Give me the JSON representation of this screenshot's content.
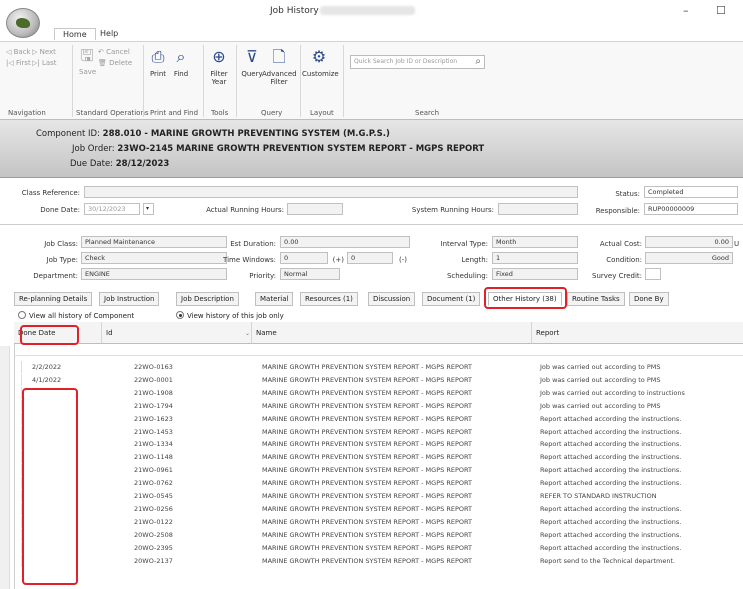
{
  "window": {
    "title": "Job History",
    "minimize": "–",
    "maximize": "☐"
  },
  "tabs": {
    "home": "Home",
    "help": "Help"
  },
  "ribbon": {
    "nav": {
      "back": "Back",
      "next": "Next",
      "first": "First",
      "last": "Last",
      "label": "Navigation"
    },
    "std": {
      "save": "Save",
      "cancel": "Cancel",
      "delete": "Delete",
      "label": "Standard Operations"
    },
    "print": {
      "print": "Print",
      "find": "Find",
      "label": "Print and Find"
    },
    "tools": {
      "filter_year": "Filter\nYear",
      "label": "Tools"
    },
    "query": {
      "query": "Query",
      "advanced": "Advanced\nFilter",
      "label": "Query"
    },
    "layout": {
      "customize": "Customize",
      "label": "Layout"
    },
    "search": {
      "placeholder": "Quick Search Job ID or Description",
      "label": "Search"
    }
  },
  "header": {
    "component_label": "Component ID:",
    "component_value": "288.010 - MARINE GROWTH PREVENTING SYSTEM (M.G.P.S.)",
    "job_order_label": "Job Order:",
    "job_order_value": "23WO-2145 MARINE GROWTH PREVENTION SYSTEM REPORT - MGPS REPORT",
    "due_label": "Due Date:",
    "due_value": "28/12/2023"
  },
  "form": {
    "class_ref_label": "Class Reference:",
    "class_ref": "",
    "done_date_label": "Done Date:",
    "done_date": "30/12/2023",
    "actual_running_label": "Actual Running Hours:",
    "actual_running": "",
    "system_running_label": "System Running Hours:",
    "system_running": "",
    "status_label": "Status:",
    "status": "Completed",
    "responsible_label": "Responsible:",
    "responsible": "RUP00000009",
    "job_class_label": "Job Class:",
    "job_class": "Planned Maintenance",
    "job_type_label": "Job Type:",
    "job_type": "Check",
    "department_label": "Department:",
    "department": "ENGINE",
    "est_duration_label": "Est Duration:",
    "est_duration": "0.00",
    "time_windows_label": "Time Windows:",
    "tw_minus": "0",
    "tw_plus_label": "(+)",
    "tw_plus": "0",
    "tw_minus_label": "(-)",
    "priority_label": "Priority:",
    "priority": "Normal",
    "interval_type_label": "Interval Type:",
    "interval_type": "Month",
    "length_label": "Length:",
    "length": "1",
    "scheduling_label": "Scheduling:",
    "scheduling": "Fixed",
    "actual_cost_label": "Actual Cost:",
    "actual_cost": "0.00",
    "actual_cost_unit": "U",
    "condition_label": "Condition:",
    "condition": "Good",
    "survey_credit_label": "Survey Credit:",
    "survey_credit": ""
  },
  "subtabs": [
    "Re-planning Details",
    "Job Instruction",
    "Job Description",
    "Material",
    "Resources (1)",
    "Discussion",
    "Document (1)",
    "Other History (38)",
    "Routine Tasks",
    "Done By"
  ],
  "radios": {
    "all": "View all history of Component",
    "this": "View history of this job only"
  },
  "columns": {
    "done_date": "Done Date",
    "id": "Id",
    "name": "Name",
    "report": "Report"
  },
  "rows": [
    {
      "date": "2/2/2022",
      "id": "22WO-0163",
      "name": "MARINE GROWTH PREVENTION SYSTEM REPORT - MGPS REPORT",
      "report": "Job was carried out according to PMS"
    },
    {
      "date": "4/1/2022",
      "id": "22WO-0001",
      "name": "MARINE GROWTH PREVENTION SYSTEM REPORT - MGPS REPORT",
      "report": "Job was carried out according to PMS"
    },
    {
      "date": "",
      "id": "21WO-1908",
      "name": "MARINE GROWTH PREVENTION SYSTEM REPORT - MGPS REPORT",
      "report": "Job was carried out according to instructions"
    },
    {
      "date": "",
      "id": "21WO-1794",
      "name": "MARINE GROWTH PREVENTION SYSTEM REPORT - MGPS REPORT",
      "report": "Job was carried out according to PMS"
    },
    {
      "date": "",
      "id": "21WO-1623",
      "name": "MARINE GROWTH PREVENTION SYSTEM REPORT - MGPS REPORT",
      "report": "Report attached according the instructions."
    },
    {
      "date": "",
      "id": "21WO-1453",
      "name": "MARINE GROWTH PREVENTION SYSTEM REPORT - MGPS REPORT",
      "report": "Report attached according the instructions."
    },
    {
      "date": "",
      "id": "21WO-1334",
      "name": "MARINE GROWTH PREVENTION SYSTEM REPORT - MGPS REPORT",
      "report": "Report attached according the instructions."
    },
    {
      "date": "",
      "id": "21WO-1148",
      "name": "MARINE GROWTH PREVENTION SYSTEM REPORT - MGPS REPORT",
      "report": "Report attached according the instructions."
    },
    {
      "date": "",
      "id": "21WO-0961",
      "name": "MARINE GROWTH PREVENTION SYSTEM REPORT - MGPS REPORT",
      "report": "Report attached according the instructions."
    },
    {
      "date": "",
      "id": "21WO-0762",
      "name": "MARINE GROWTH PREVENTION SYSTEM REPORT - MGPS REPORT",
      "report": "Report attached according the instructions."
    },
    {
      "date": "",
      "id": "21WO-0545",
      "name": "MARINE GROWTH PREVENTION SYSTEM REPORT - MGPS REPORT",
      "report": "REFER TO STANDARD INSTRUCTION"
    },
    {
      "date": "",
      "id": "21WO-0256",
      "name": "MARINE GROWTH PREVENTION SYSTEM REPORT - MGPS REPORT",
      "report": "Report attached according the instructions."
    },
    {
      "date": "",
      "id": "21WO-0122",
      "name": "MARINE GROWTH PREVENTION SYSTEM REPORT - MGPS REPORT",
      "report": "Report attached according the instructions."
    },
    {
      "date": "",
      "id": "20WO-2508",
      "name": "MARINE GROWTH PREVENTION SYSTEM REPORT - MGPS REPORT",
      "report": "Report attached according the instructions."
    },
    {
      "date": "",
      "id": "20WO-2395",
      "name": "MARINE GROWTH PREVENTION SYSTEM REPORT - MGPS REPORT",
      "report": "Report attached according the instructions."
    },
    {
      "date": "",
      "id": "20WO-2137",
      "name": "MARINE GROWTH PREVENTION SYSTEM REPORT - MGPS REPORT",
      "report": "Report send to the Technical department."
    }
  ],
  "colors": {
    "highlight": "#e0212a",
    "icon": "#2c4b8c"
  }
}
